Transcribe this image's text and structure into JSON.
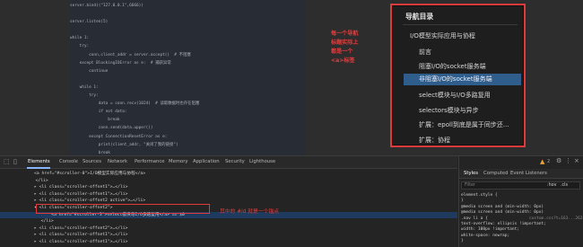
{
  "code": {
    "lines": [
      "server.bind((\"127.0.0.1\",6666))",
      "",
      "server.listen(5)",
      "",
      "while 1:",
      "    try:",
      "        conn,client_addr = server.accept()  # 不阻塞",
      "    except BlockingIOError as e:  # 捕获异常",
      "        continue",
      "",
      "    while 1:",
      "        try:",
      "            data = conn.recv(1024)  # 读取数据时也存在阻塞",
      "            if not data:",
      "                break",
      "            conn.send(data.upper())",
      "        except ConnectionResetError as e:",
      "            print(client_addr, \"关闭了我的链接\")",
      "            break",
      "        except BlockingIOError as e:  # 捕获异常",
      "            pass"
    ]
  },
  "annotation": {
    "lines": [
      "每一个导航",
      "标题实际上",
      "都是一个",
      "<a>标签"
    ]
  },
  "nav": {
    "title": "导航目录",
    "items": [
      "I/O模型实际应用与协程",
      "前言",
      "阻塞I/O的socket服务端",
      "非阻塞I/O的socket服务端",
      "select模块与I/O多路复用",
      "selectors模块与异步",
      "扩展：epoll到底是属于同步还...",
      "扩展：协程"
    ],
    "active_index": 3
  },
  "devtools": {
    "tabs": [
      "Elements",
      "Console",
      "Sources",
      "Network",
      "Performance",
      "Memory",
      "Application",
      "Security",
      "Lighthouse"
    ],
    "selected_tab": "Elements",
    "badge": "2",
    "rows": [
      "<a href=\"#scroller-0\">I/O模型实际应用与协程</a>",
      "  </li>",
      "▸ <li class=\"scroller-offset1\">…</li>",
      "▸ <li class=\"scroller-offset1\">…</li>",
      "▸ <li class=\"scroller-offset2 active\">…</li>",
      "▾ <li class=\"scroller-offset2\">",
      "    <a href=\"#scroller-3\">select模块与I/O多路复用</a> == $0",
      "  </li>",
      "▸ <li class=\"scroller-offset2\">…</li>",
      "▸ <li class=\"scroller-offset1\">…</li>",
      "▸ <li class=\"scroller-offset1\">…</li>"
    ],
    "highlight_note": "其中的 #id 就是一个锚点",
    "styles_tabs": [
      "Styles",
      "Computed",
      "Event Listeners"
    ],
    "selected_styles_tab": "Styles",
    "filter_placeholder": "Filter",
    "hov": ":hov",
    "cls": ".cls",
    "style_lines": [
      "element.style {",
      "}",
      "@media screen and (min-width: 0px)",
      "@media screen and (min-width: 0px)",
      ".nav li a {",
      "  text-overflow: ellipsis !important;",
      "  width: 100px !important;",
      "  white-space: nowrap;",
      "}"
    ],
    "style_source": "custom.css?t=163...2628"
  },
  "colors": {
    "accent": "#e03a3a",
    "selection": "#1f3a5f",
    "active_nav": "#2f5d8c"
  }
}
